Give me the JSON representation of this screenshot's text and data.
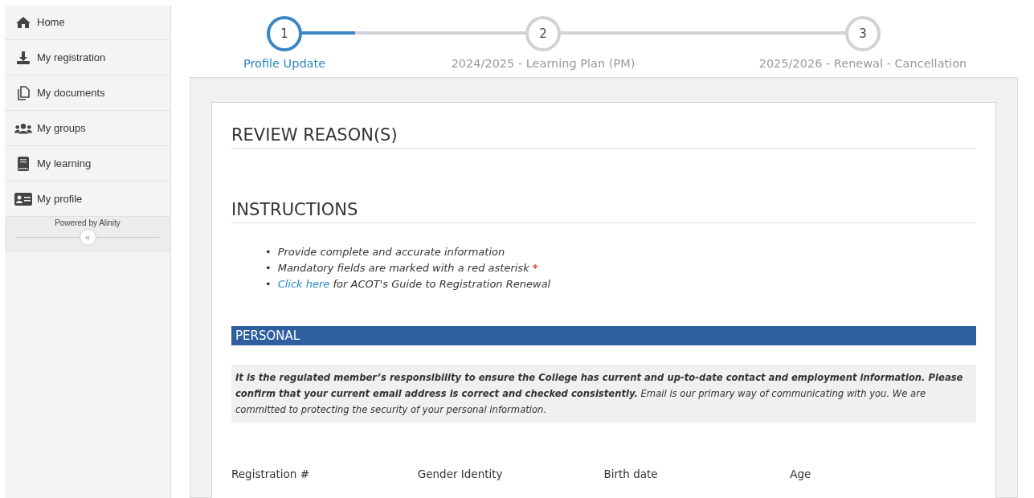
{
  "sidebar": {
    "items": [
      {
        "label": "Home",
        "selected": false
      },
      {
        "label": "My registration",
        "selected": false
      },
      {
        "label": "My documents",
        "selected": false
      },
      {
        "label": "My groups",
        "selected": false
      },
      {
        "label": "My learning",
        "selected": false
      },
      {
        "label": "My profile",
        "selected": false
      }
    ],
    "powered_by": "Powered by Alinity",
    "collapse": "«"
  },
  "stepper": {
    "steps": [
      {
        "number": "1",
        "label": "Profile Update",
        "selected": true
      },
      {
        "number": "2",
        "label": "2024/2025 - Learning Plan (PM)",
        "selected": false
      },
      {
        "number": "3",
        "label": "2025/2026 - Renewal - Cancellation",
        "selected": false
      }
    ]
  },
  "form": {
    "review_heading": "REVIEW REASON(S)",
    "instructions_heading": "INSTRUCTIONS",
    "instructions": [
      {
        "kind": "plain",
        "bullet": "•",
        "text": "Provide complete and accurate information"
      },
      {
        "kind": "required",
        "bullet": "•",
        "text": "Mandatory fields are marked with a red asterisk",
        "mark": "*"
      },
      {
        "kind": "link",
        "bullet": "•",
        "link": "Click here",
        "text": " for ACOT's Guide to Registration Renewal"
      }
    ],
    "section_title": "PERSONAL",
    "notice": "**It is the regulated member’s responsibility to ensure the College has current and up-to-date contact and employment information. Please confirm that your current email address is correct and checked consistently.** Email is our primary way of communicating with you. We are committed to protecting the security of your personal information.",
    "field_labels": [
      "Registration #",
      "Gender Identity",
      "Birth date",
      "Age"
    ]
  }
}
